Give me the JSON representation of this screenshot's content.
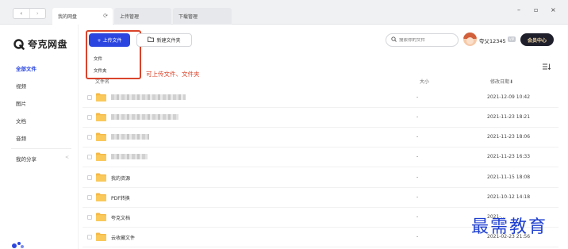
{
  "titlebar": {
    "back": "‹",
    "forward": "›",
    "tabs": [
      {
        "label": "我的网盘",
        "reload": "⟳"
      },
      {
        "label": "上传管理"
      },
      {
        "label": "下载管理"
      }
    ],
    "window_controls": {
      "minimize": "–",
      "maximize": "▫",
      "close": "×"
    }
  },
  "brand": {
    "name": "夸克网盘",
    "icon": "quark-logo-icon"
  },
  "sidebar": {
    "items": [
      {
        "label": "全部文件",
        "active": true
      },
      {
        "label": "视频"
      },
      {
        "label": "图片"
      },
      {
        "label": "文档"
      },
      {
        "label": "音频"
      },
      {
        "label": "我的分享"
      }
    ]
  },
  "toolbar": {
    "upload_label": "+ 上传文件",
    "upload_menu": [
      "文件",
      "文件夹"
    ],
    "new_folder_label": "新建文件夹",
    "search_placeholder": "搜索你的文件"
  },
  "user": {
    "name": "夸父12345",
    "tag": "VIP",
    "member_label": "会员中心"
  },
  "annotation": "可上传文件、文件夹",
  "table": {
    "headers": {
      "name": "文件名",
      "size": "大小",
      "date": "修改日期⬇"
    },
    "rows": [
      {
        "name": "",
        "blurred": true,
        "blur_fraction": 0.55,
        "size": "-",
        "date": "2021-12-09 10:42"
      },
      {
        "name": "",
        "blurred": true,
        "blur_fraction": 0.5,
        "size": "-",
        "date": "2021-11-23 18:21"
      },
      {
        "name": "",
        "blurred": true,
        "blur_fraction": 0.28,
        "size": "-",
        "date": "2021-11-23 18:06"
      },
      {
        "name": "",
        "blurred": true,
        "blur_fraction": 0.27,
        "size": "-",
        "date": "2021-11-23 16:33"
      },
      {
        "name": "我的资源",
        "size": "-",
        "date": "2021-11-15 18:08"
      },
      {
        "name": "PDF转换",
        "size": "-",
        "date": "2021-10-12 14:18"
      },
      {
        "name": "夸克文档",
        "size": "-",
        "date": "2021-..."
      },
      {
        "name": "云收藏文件",
        "size": "-",
        "date": "2021-02-23 21:56"
      }
    ]
  },
  "watermark": "最需教育",
  "colors": {
    "accent": "#2b46e0",
    "annotation": "#d9442b",
    "folder": "#f5b945",
    "member_bg": "#1e1f2b"
  }
}
